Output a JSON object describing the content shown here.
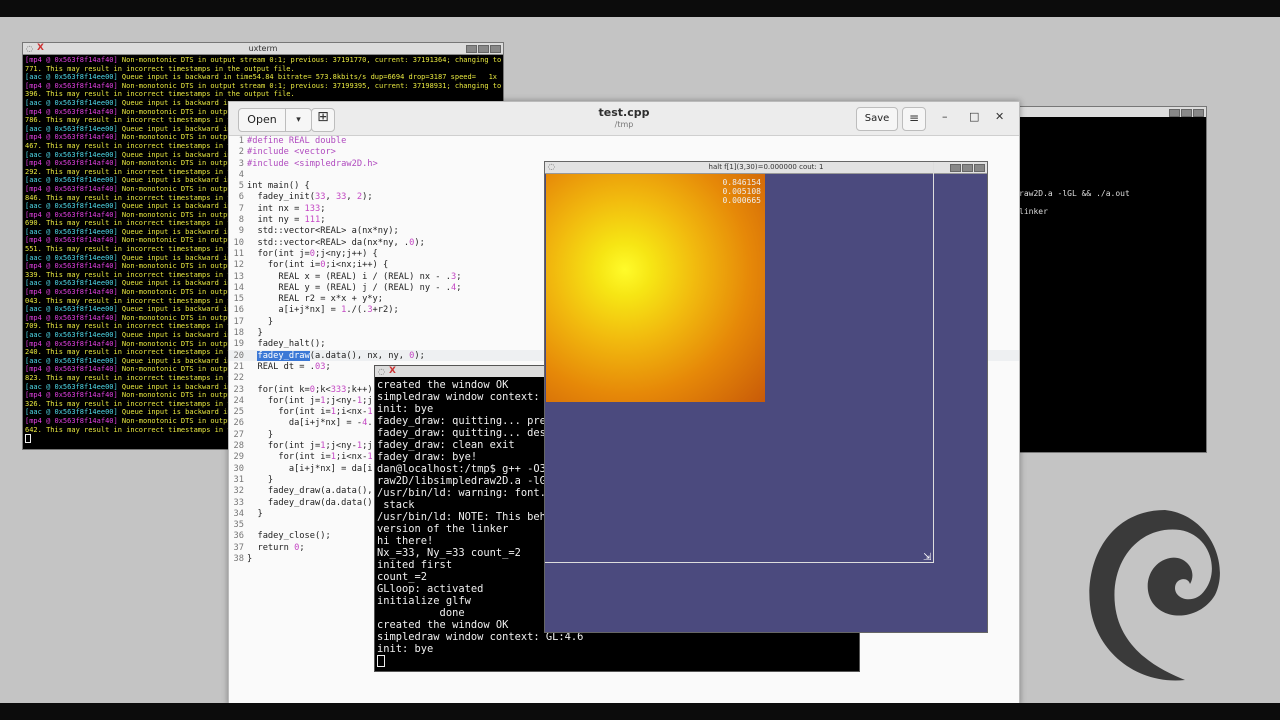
{
  "xterm": {
    "title": "uxterm",
    "lines": [
      {
        "tag": "[mp4 @ 0x563f8f14af40]",
        "kind": "m",
        "text": " Non-monotonic DTS in output stream 0:1; previous: 37191770, current: 37191364; changing to 37191"
      },
      {
        "tag": "",
        "kind": "",
        "text": "771. This may result in incorrect timestamps in the output file."
      },
      {
        "tag": "[aac @ 0x563f8f14ee00]",
        "kind": "a",
        "text": " Queue input is backward in time54.84 bitrate= 573.8kbits/s dup=6694 drop=3187 speed=   1x"
      },
      {
        "tag": "[mp4 @ 0x563f8f14af40]",
        "kind": "m",
        "text": " Non-monotonic DTS in output stream 0:1; previous: 37199395, current: 37198931; changing to 37199"
      },
      {
        "tag": "",
        "kind": "",
        "text": "396. This may result in incorrect timestamps in the output file."
      },
      {
        "tag": "[aac @ 0x563f8f14ee00]",
        "kind": "a",
        "text": " Queue input is backward in"
      },
      {
        "tag": "[mp4 @ 0x563f8f14af40]",
        "kind": "m",
        "text": " Non-monotonic DTS in output"
      },
      {
        "tag": "",
        "kind": "",
        "text": "786. This may result in incorrect timestamps in the"
      },
      {
        "tag": "[aac @ 0x563f8f14ee00]",
        "kind": "a",
        "text": " Queue input is backward in"
      },
      {
        "tag": "[mp4 @ 0x563f8f14af40]",
        "kind": "m",
        "text": " Non-monotonic DTS in output"
      },
      {
        "tag": "",
        "kind": "",
        "text": "467. This may result in incorrect timestamps in the"
      },
      {
        "tag": "[aac @ 0x563f8f14ee00]",
        "kind": "a",
        "text": " Queue input is backward in"
      },
      {
        "tag": "[mp4 @ 0x563f8f14af40]",
        "kind": "m",
        "text": " Non-monotonic DTS in output"
      },
      {
        "tag": "",
        "kind": "",
        "text": "292. This may result in incorrect timestamps in the"
      },
      {
        "tag": "[aac @ 0x563f8f14ee00]",
        "kind": "a",
        "text": " Queue input is backward in"
      },
      {
        "tag": "[mp4 @ 0x563f8f14af40]",
        "kind": "m",
        "text": " Non-monotonic DTS in output"
      },
      {
        "tag": "",
        "kind": "",
        "text": "846. This may result in incorrect timestamps in the"
      },
      {
        "tag": "[aac @ 0x563f8f14ee00]",
        "kind": "a",
        "text": " Queue input is backward in"
      },
      {
        "tag": "[mp4 @ 0x563f8f14af40]",
        "kind": "m",
        "text": " Non-monotonic DTS in output"
      },
      {
        "tag": "",
        "kind": "",
        "text": "690. This may result in incorrect timestamps in the"
      },
      {
        "tag": "[aac @ 0x563f8f14ee00]",
        "kind": "a",
        "text": " Queue input is backward in"
      },
      {
        "tag": "[mp4 @ 0x563f8f14af40]",
        "kind": "m",
        "text": " Non-monotonic DTS in output"
      },
      {
        "tag": "",
        "kind": "",
        "text": "551. This may result in incorrect timestamps in the"
      },
      {
        "tag": "[aac @ 0x563f8f14ee00]",
        "kind": "a",
        "text": " Queue input is backward in"
      },
      {
        "tag": "[mp4 @ 0x563f8f14af40]",
        "kind": "m",
        "text": " Non-monotonic DTS in output"
      },
      {
        "tag": "",
        "kind": "",
        "text": "339. This may result in incorrect timestamps in the"
      },
      {
        "tag": "[aac @ 0x563f8f14ee00]",
        "kind": "a",
        "text": " Queue input is backward in"
      },
      {
        "tag": "[mp4 @ 0x563f8f14af40]",
        "kind": "m",
        "text": " Non-monotonic DTS in output"
      },
      {
        "tag": "",
        "kind": "",
        "text": "043. This may result in incorrect timestamps in the"
      },
      {
        "tag": "[aac @ 0x563f8f14ee00]",
        "kind": "a",
        "text": " Queue input is backward in"
      },
      {
        "tag": "[mp4 @ 0x563f8f14af40]",
        "kind": "m",
        "text": " Non-monotonic DTS in output"
      },
      {
        "tag": "",
        "kind": "",
        "text": "709. This may result in incorrect timestamps in the"
      },
      {
        "tag": "[aac @ 0x563f8f14ee00]",
        "kind": "a",
        "text": " Queue input is backward in"
      },
      {
        "tag": "[mp4 @ 0x563f8f14af40]",
        "kind": "m",
        "text": " Non-monotonic DTS in output"
      },
      {
        "tag": "",
        "kind": "",
        "text": "240. This may result in incorrect timestamps in the"
      },
      {
        "tag": "[aac @ 0x563f8f14ee00]",
        "kind": "a",
        "text": " Queue input is backward in"
      },
      {
        "tag": "[mp4 @ 0x563f8f14af40]",
        "kind": "m",
        "text": " Non-monotonic DTS in output"
      },
      {
        "tag": "",
        "kind": "",
        "text": "823. This may result in incorrect timestamps in the"
      },
      {
        "tag": "[aac @ 0x563f8f14ee00]",
        "kind": "a",
        "text": " Queue input is backward in"
      },
      {
        "tag": "[mp4 @ 0x563f8f14af40]",
        "kind": "m",
        "text": " Non-monotonic DTS in output"
      },
      {
        "tag": "",
        "kind": "",
        "text": "326. This may result in incorrect timestamps in the"
      },
      {
        "tag": "[aac @ 0x563f8f14ee00]",
        "kind": "a",
        "text": " Queue input is backward in"
      },
      {
        "tag": "[mp4 @ 0x563f8f14af40]",
        "kind": "m",
        "text": " Non-monotonic DTS in output"
      },
      {
        "tag": "",
        "kind": "",
        "text": "642. This may result in incorrect timestamps in the"
      }
    ]
  },
  "term2": {
    "lines": [
      "raw2D.a -lGL && ./a.out",
      "linker"
    ]
  },
  "gedit": {
    "open_label": "Open",
    "title": "test.cpp",
    "subtitle": "/tmp",
    "save_label": "Save",
    "code": [
      "#define REAL double",
      "#include <vector>",
      "#include <simpledraw2D.h>",
      "",
      "int main() {",
      "  fadey_init(33, 33, 2);",
      "  int nx = 133;",
      "  int ny = 111;",
      "  std::vector<REAL> a(nx*ny);",
      "  std::vector<REAL> da(nx*ny, .0);",
      "  for(int j=0;j<ny;j++) {",
      "    for(int i=0;i<nx;i++) {",
      "      REAL x = (REAL) i / (REAL) nx - .3;",
      "      REAL y = (REAL) j / (REAL) ny - .4;",
      "      REAL r2 = x*x + y*y;",
      "      a[i+j*nx] = 1./(.3+r2);",
      "    }",
      "  }",
      "  fadey_halt();",
      "  fadey_draw(a.data(), nx, ny, 0);",
      "  REAL dt = .03;",
      "",
      "  for(int k=0;k<333;k++)",
      "    for(int j=1;j<ny-1;j",
      "      for(int i=1;i<nx-1",
      "        da[i+j*nx] = -4.",
      "    }",
      "    for(int j=1;j<ny-1;j",
      "      for(int i=1;i<nx-1",
      "        a[i+j*nx] = da[i",
      "    }",
      "    fadey_draw(a.data(),",
      "    fadey_draw(da.data()",
      "  }",
      "",
      "  fadey_close();",
      "  return 0;",
      "}"
    ],
    "selected_text": "fadey_draw",
    "cursor_line": 20
  },
  "terminal": {
    "lines": [
      "created the window OK",
      "simpledraw window context: G",
      "init: bye",
      "fadey_draw: quitting... prep",
      "fadey_draw: quitting... dest",
      "fadey_draw: clean exit",
      "fadey draw: bye!",
      "dan@localhost:/tmp$ g++ -O3",
      "raw2D/libsimpledraw2D.a -lGL",
      "/usr/bin/ld: warning: font.o",
      " stack",
      "/usr/bin/ld: NOTE: This beha",
      "version of the linker",
      "hi there!",
      "Nx_=33, Ny_=33 count_=2",
      "inited first",
      "count_=2",
      "GLloop: activated",
      "initialize glfw",
      "          done",
      "created the window OK",
      "simpledraw window context: GL:4.6",
      "init: bye"
    ]
  },
  "halt": {
    "title": "halt  f[1](3,30)=0.000000   cout: 1",
    "hud": [
      "0.846154",
      "0.005108",
      "0.000665"
    ]
  }
}
